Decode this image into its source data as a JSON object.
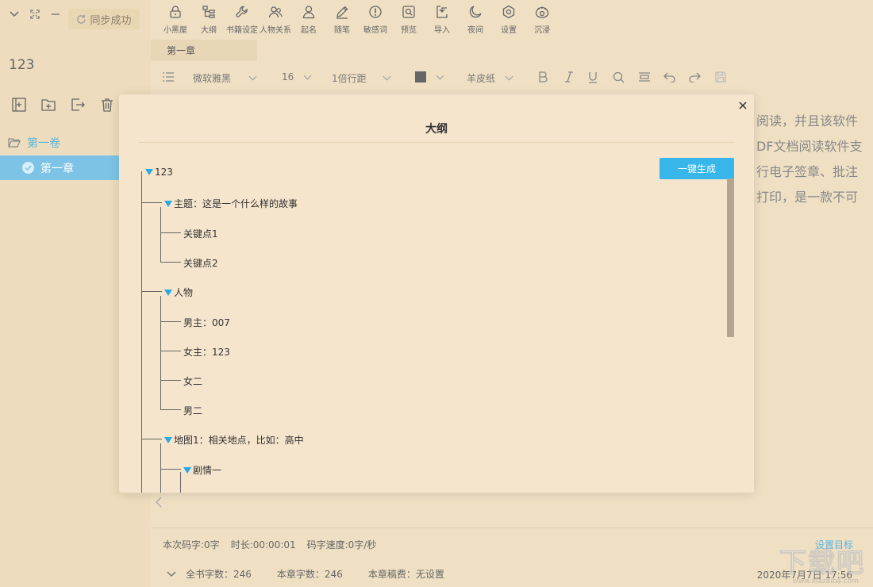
{
  "sidebar": {
    "sync_label": "同步成功",
    "book_title": "123",
    "volume_label": "第一卷",
    "chapter_label": "第一章"
  },
  "toolbar": {
    "items": [
      {
        "label": "小黑屋",
        "icon": "lock-icon"
      },
      {
        "label": "大纲",
        "icon": "outline-icon"
      },
      {
        "label": "书籍设定",
        "icon": "wrench-icon"
      },
      {
        "label": "人物关系",
        "icon": "people-icon"
      },
      {
        "label": "起名",
        "icon": "person-icon"
      },
      {
        "label": "随笔",
        "icon": "pen-icon"
      },
      {
        "label": "敏感词",
        "icon": "alert-icon"
      },
      {
        "label": "预览",
        "icon": "preview-icon"
      },
      {
        "label": "导入",
        "icon": "import-icon"
      },
      {
        "label": "夜间",
        "icon": "moon-icon"
      },
      {
        "label": "设置",
        "icon": "gear-icon"
      },
      {
        "label": "沉浸",
        "icon": "eye-icon"
      }
    ]
  },
  "tabs": {
    "active": "第一章"
  },
  "format": {
    "font": "微软雅黑",
    "size": "16",
    "line_spacing": "1倍行距",
    "text_color": "#666666",
    "background": "羊皮纸"
  },
  "editor": {
    "lines": [
      "阅读，并且该软件",
      "DF文档阅读软件支",
      "行电子签章、批注",
      "打印，是一款不可"
    ]
  },
  "modal": {
    "title": "大纲",
    "generate_label": "一键生成",
    "tree": {
      "root": "123",
      "n1": "主题：这是一个什么样的故事",
      "n1a": "关键点1",
      "n1b": "关键点2",
      "n2": "人物",
      "n2a": "男主：007",
      "n2b": "女主：123",
      "n2c": "女二",
      "n2d": "男二",
      "n3": "地图1：相关地点，比如：高中",
      "n3a": "剧情一"
    }
  },
  "status": {
    "code_count": "本次码字:0字",
    "duration": "时长:00:00:01",
    "speed": "码字速度:0字/秒",
    "target_link": "设置目标",
    "book_words": "全书字数：246",
    "chapter_words": "本章字数：246",
    "fee": "本章稿费：无设置",
    "datetime": "2020年7月7日 17:56"
  },
  "watermark": {
    "text": "下载吧",
    "url": "www.xiazaiba.com"
  },
  "colors": {
    "accent": "#37b6ea",
    "selected_row": "#7dc3e6",
    "background": "#efe0c4",
    "modal": "#f6e5cd"
  }
}
